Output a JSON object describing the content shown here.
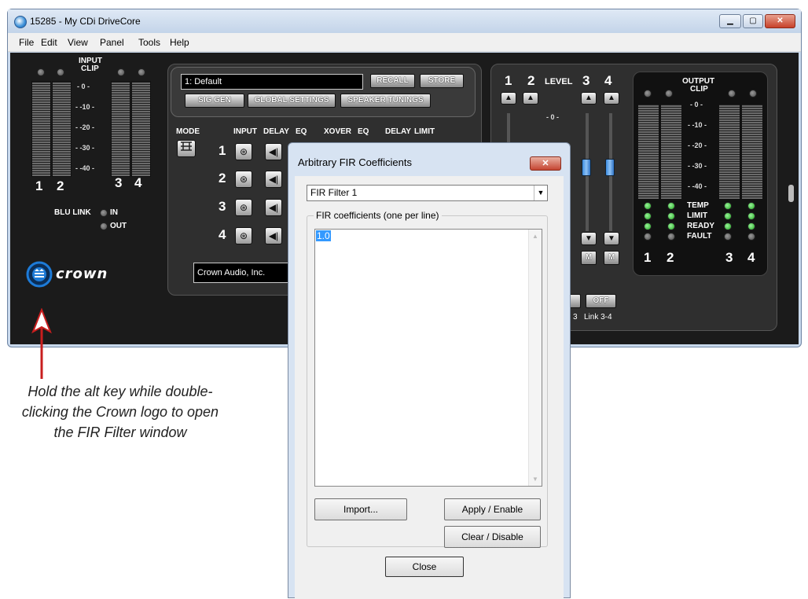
{
  "window": {
    "title": "15285 - My CDi DriveCore",
    "minimize": "▁",
    "maximize": "▢",
    "close": "✕"
  },
  "menu": [
    "File",
    "Edit",
    "View",
    "Panel",
    "Tools",
    "Help"
  ],
  "input_section": {
    "title": "INPUT",
    "clip": "CLIP",
    "scale": [
      "0",
      "-10",
      "-20",
      "-30",
      "-40"
    ],
    "channels": [
      "1",
      "2",
      "3",
      "4"
    ],
    "blu_link": "BLU LINK",
    "in": "IN",
    "out": "OUT"
  },
  "brand": {
    "logo_text": "crown"
  },
  "center": {
    "preset_value": "1: Default",
    "recall": "RECALL",
    "store": "STORE",
    "sig_gen": "SIG GEN",
    "global_settings": "GLOBAL SETTINGS",
    "speaker_tunings": "SPEAKER TUNINGS",
    "mode": "MODE",
    "columns": [
      "INPUT",
      "DELAY",
      "EQ",
      "XOVER",
      "EQ",
      "DELAY",
      "LIMIT"
    ],
    "channels": [
      "1",
      "2",
      "3",
      "4"
    ],
    "company": "Crown Audio, Inc."
  },
  "level_section": {
    "nums": [
      "1",
      "2",
      "3",
      "4"
    ],
    "level": "LEVEL",
    "scale_top": "0",
    "mute": "M",
    "off": "OFF",
    "link_label": "Link 3-4",
    "partial_label": "3"
  },
  "output_section": {
    "title": "OUTPUT",
    "clip": "CLIP",
    "scale": [
      "0",
      "-10",
      "-20",
      "-30",
      "-40"
    ],
    "status": [
      "TEMP",
      "LIMIT",
      "READY",
      "FAULT"
    ],
    "channels": [
      "1",
      "2",
      "3",
      "4"
    ]
  },
  "dialog": {
    "title": "Arbitrary FIR Coefficients",
    "filter_select": "FIR Filter 1",
    "group_label": "FIR coefficients (one per line)",
    "coefficients": "1.0",
    "import": "Import...",
    "apply": "Apply / Enable",
    "clear": "Clear / Disable",
    "close": "Close"
  },
  "annotation": {
    "lines": [
      "Hold the alt key while double-",
      "clicking the Crown logo to open",
      "the FIR Filter window"
    ]
  },
  "colors": {
    "arrow": "#c81e1e",
    "fader_knob": "#3d8ce0",
    "led_green": "#1ea81e",
    "logo_blue": "#1d7bd8"
  }
}
